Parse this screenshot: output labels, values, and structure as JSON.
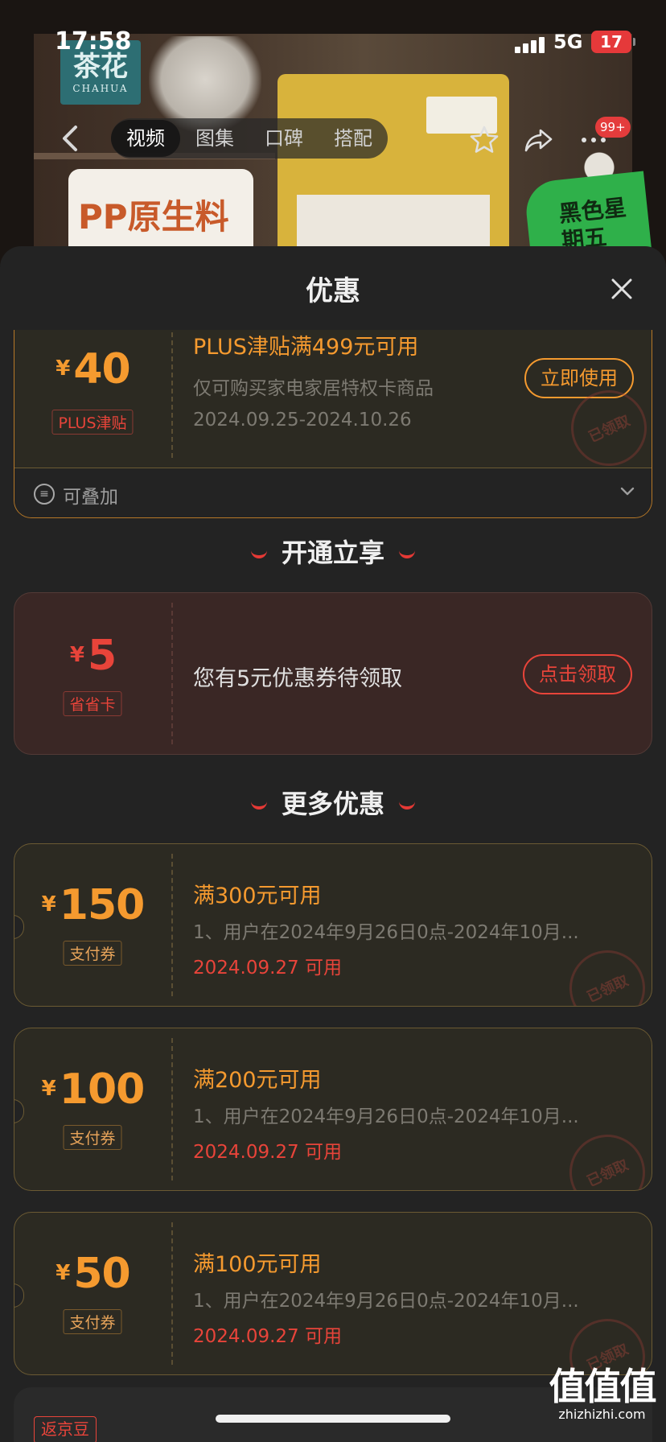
{
  "status_bar": {
    "time": "17:58",
    "network": "5G",
    "battery": "17"
  },
  "header": {
    "tabs": [
      "视频",
      "图集",
      "口碑",
      "搭配"
    ],
    "active_tab_index": 0,
    "more_badge": "99+",
    "product_image_texts": {
      "brand": "茶花",
      "brand_en": "CHAHUA",
      "material": "PP原生料",
      "promo": "黑色星期五"
    }
  },
  "sheet": {
    "title": "优惠",
    "plus_coupon": {
      "currency": "¥",
      "amount": "40",
      "tag": "PLUS津贴",
      "title": "PLUS津贴满499元可用",
      "scope": "仅可购买家电家居特权卡商品",
      "validity": "2024.09.25-2024.10.26",
      "action": "立即使用",
      "stamp": "已领取",
      "stackable": "可叠加"
    },
    "section_open": {
      "heading": "开通立享",
      "coupon": {
        "currency": "¥",
        "amount": "5",
        "tag": "省省卡",
        "message": "您有5元优惠券待领取",
        "action": "点击领取"
      }
    },
    "section_more": {
      "heading": "更多优惠",
      "coupons": [
        {
          "currency": "¥",
          "amount": "150",
          "tag": "支付券",
          "title": "满300元可用",
          "desc": "1、用户在2024年9月26日0点-2024年10月...",
          "date": "2024.09.27 可用",
          "stamp": "已领取"
        },
        {
          "currency": "¥",
          "amount": "100",
          "tag": "支付券",
          "title": "满200元可用",
          "desc": "1、用户在2024年9月26日0点-2024年10月...",
          "date": "2024.09.27 可用",
          "stamp": "已领取"
        },
        {
          "currency": "¥",
          "amount": "50",
          "tag": "支付券",
          "title": "满100元可用",
          "desc": "1、用户在2024年9月26日0点-2024年10月...",
          "date": "2024.09.27 可用",
          "stamp": "已领取"
        }
      ]
    },
    "next_tag": "返京豆"
  },
  "watermark": {
    "logo": "值值值",
    "url": "zhizhizhi.com"
  },
  "colors": {
    "accent_orange": "#f59a2f",
    "accent_red": "#e8443a",
    "sheet_bg": "#232323",
    "card_bg": "#2c2a22"
  }
}
